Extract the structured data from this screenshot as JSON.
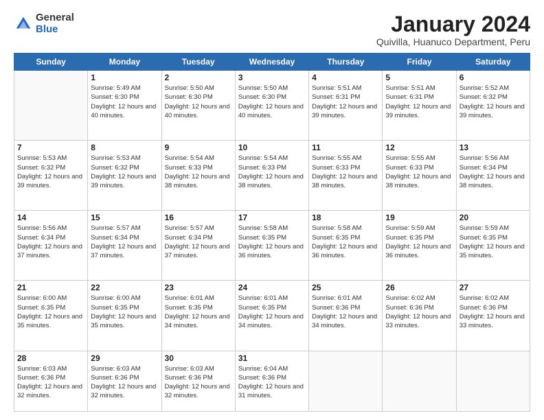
{
  "logo": {
    "general": "General",
    "blue": "Blue"
  },
  "title": {
    "month": "January 2024",
    "location": "Quivilla, Huanuco Department, Peru"
  },
  "weekdays": [
    "Sunday",
    "Monday",
    "Tuesday",
    "Wednesday",
    "Thursday",
    "Friday",
    "Saturday"
  ],
  "weeks": [
    [
      {
        "day": "",
        "sunrise": "",
        "sunset": "",
        "daylight": ""
      },
      {
        "day": "1",
        "sunrise": "Sunrise: 5:49 AM",
        "sunset": "Sunset: 6:30 PM",
        "daylight": "Daylight: 12 hours and 40 minutes."
      },
      {
        "day": "2",
        "sunrise": "Sunrise: 5:50 AM",
        "sunset": "Sunset: 6:30 PM",
        "daylight": "Daylight: 12 hours and 40 minutes."
      },
      {
        "day": "3",
        "sunrise": "Sunrise: 5:50 AM",
        "sunset": "Sunset: 6:30 PM",
        "daylight": "Daylight: 12 hours and 40 minutes."
      },
      {
        "day": "4",
        "sunrise": "Sunrise: 5:51 AM",
        "sunset": "Sunset: 6:31 PM",
        "daylight": "Daylight: 12 hours and 39 minutes."
      },
      {
        "day": "5",
        "sunrise": "Sunrise: 5:51 AM",
        "sunset": "Sunset: 6:31 PM",
        "daylight": "Daylight: 12 hours and 39 minutes."
      },
      {
        "day": "6",
        "sunrise": "Sunrise: 5:52 AM",
        "sunset": "Sunset: 6:32 PM",
        "daylight": "Daylight: 12 hours and 39 minutes."
      }
    ],
    [
      {
        "day": "7",
        "sunrise": "Sunrise: 5:53 AM",
        "sunset": "Sunset: 6:32 PM",
        "daylight": "Daylight: 12 hours and 39 minutes."
      },
      {
        "day": "8",
        "sunrise": "Sunrise: 5:53 AM",
        "sunset": "Sunset: 6:32 PM",
        "daylight": "Daylight: 12 hours and 39 minutes."
      },
      {
        "day": "9",
        "sunrise": "Sunrise: 5:54 AM",
        "sunset": "Sunset: 6:33 PM",
        "daylight": "Daylight: 12 hours and 38 minutes."
      },
      {
        "day": "10",
        "sunrise": "Sunrise: 5:54 AM",
        "sunset": "Sunset: 6:33 PM",
        "daylight": "Daylight: 12 hours and 38 minutes."
      },
      {
        "day": "11",
        "sunrise": "Sunrise: 5:55 AM",
        "sunset": "Sunset: 6:33 PM",
        "daylight": "Daylight: 12 hours and 38 minutes."
      },
      {
        "day": "12",
        "sunrise": "Sunrise: 5:55 AM",
        "sunset": "Sunset: 6:33 PM",
        "daylight": "Daylight: 12 hours and 38 minutes."
      },
      {
        "day": "13",
        "sunrise": "Sunrise: 5:56 AM",
        "sunset": "Sunset: 6:34 PM",
        "daylight": "Daylight: 12 hours and 38 minutes."
      }
    ],
    [
      {
        "day": "14",
        "sunrise": "Sunrise: 5:56 AM",
        "sunset": "Sunset: 6:34 PM",
        "daylight": "Daylight: 12 hours and 37 minutes."
      },
      {
        "day": "15",
        "sunrise": "Sunrise: 5:57 AM",
        "sunset": "Sunset: 6:34 PM",
        "daylight": "Daylight: 12 hours and 37 minutes."
      },
      {
        "day": "16",
        "sunrise": "Sunrise: 5:57 AM",
        "sunset": "Sunset: 6:34 PM",
        "daylight": "Daylight: 12 hours and 37 minutes."
      },
      {
        "day": "17",
        "sunrise": "Sunrise: 5:58 AM",
        "sunset": "Sunset: 6:35 PM",
        "daylight": "Daylight: 12 hours and 36 minutes."
      },
      {
        "day": "18",
        "sunrise": "Sunrise: 5:58 AM",
        "sunset": "Sunset: 6:35 PM",
        "daylight": "Daylight: 12 hours and 36 minutes."
      },
      {
        "day": "19",
        "sunrise": "Sunrise: 5:59 AM",
        "sunset": "Sunset: 6:35 PM",
        "daylight": "Daylight: 12 hours and 36 minutes."
      },
      {
        "day": "20",
        "sunrise": "Sunrise: 5:59 AM",
        "sunset": "Sunset: 6:35 PM",
        "daylight": "Daylight: 12 hours and 35 minutes."
      }
    ],
    [
      {
        "day": "21",
        "sunrise": "Sunrise: 6:00 AM",
        "sunset": "Sunset: 6:35 PM",
        "daylight": "Daylight: 12 hours and 35 minutes."
      },
      {
        "day": "22",
        "sunrise": "Sunrise: 6:00 AM",
        "sunset": "Sunset: 6:35 PM",
        "daylight": "Daylight: 12 hours and 35 minutes."
      },
      {
        "day": "23",
        "sunrise": "Sunrise: 6:01 AM",
        "sunset": "Sunset: 6:35 PM",
        "daylight": "Daylight: 12 hours and 34 minutes."
      },
      {
        "day": "24",
        "sunrise": "Sunrise: 6:01 AM",
        "sunset": "Sunset: 6:35 PM",
        "daylight": "Daylight: 12 hours and 34 minutes."
      },
      {
        "day": "25",
        "sunrise": "Sunrise: 6:01 AM",
        "sunset": "Sunset: 6:36 PM",
        "daylight": "Daylight: 12 hours and 34 minutes."
      },
      {
        "day": "26",
        "sunrise": "Sunrise: 6:02 AM",
        "sunset": "Sunset: 6:36 PM",
        "daylight": "Daylight: 12 hours and 33 minutes."
      },
      {
        "day": "27",
        "sunrise": "Sunrise: 6:02 AM",
        "sunset": "Sunset: 6:36 PM",
        "daylight": "Daylight: 12 hours and 33 minutes."
      }
    ],
    [
      {
        "day": "28",
        "sunrise": "Sunrise: 6:03 AM",
        "sunset": "Sunset: 6:36 PM",
        "daylight": "Daylight: 12 hours and 32 minutes."
      },
      {
        "day": "29",
        "sunrise": "Sunrise: 6:03 AM",
        "sunset": "Sunset: 6:36 PM",
        "daylight": "Daylight: 12 hours and 32 minutes."
      },
      {
        "day": "30",
        "sunrise": "Sunrise: 6:03 AM",
        "sunset": "Sunset: 6:36 PM",
        "daylight": "Daylight: 12 hours and 32 minutes."
      },
      {
        "day": "31",
        "sunrise": "Sunrise: 6:04 AM",
        "sunset": "Sunset: 6:36 PM",
        "daylight": "Daylight: 12 hours and 31 minutes."
      },
      {
        "day": "",
        "sunrise": "",
        "sunset": "",
        "daylight": ""
      },
      {
        "day": "",
        "sunrise": "",
        "sunset": "",
        "daylight": ""
      },
      {
        "day": "",
        "sunrise": "",
        "sunset": "",
        "daylight": ""
      }
    ]
  ]
}
